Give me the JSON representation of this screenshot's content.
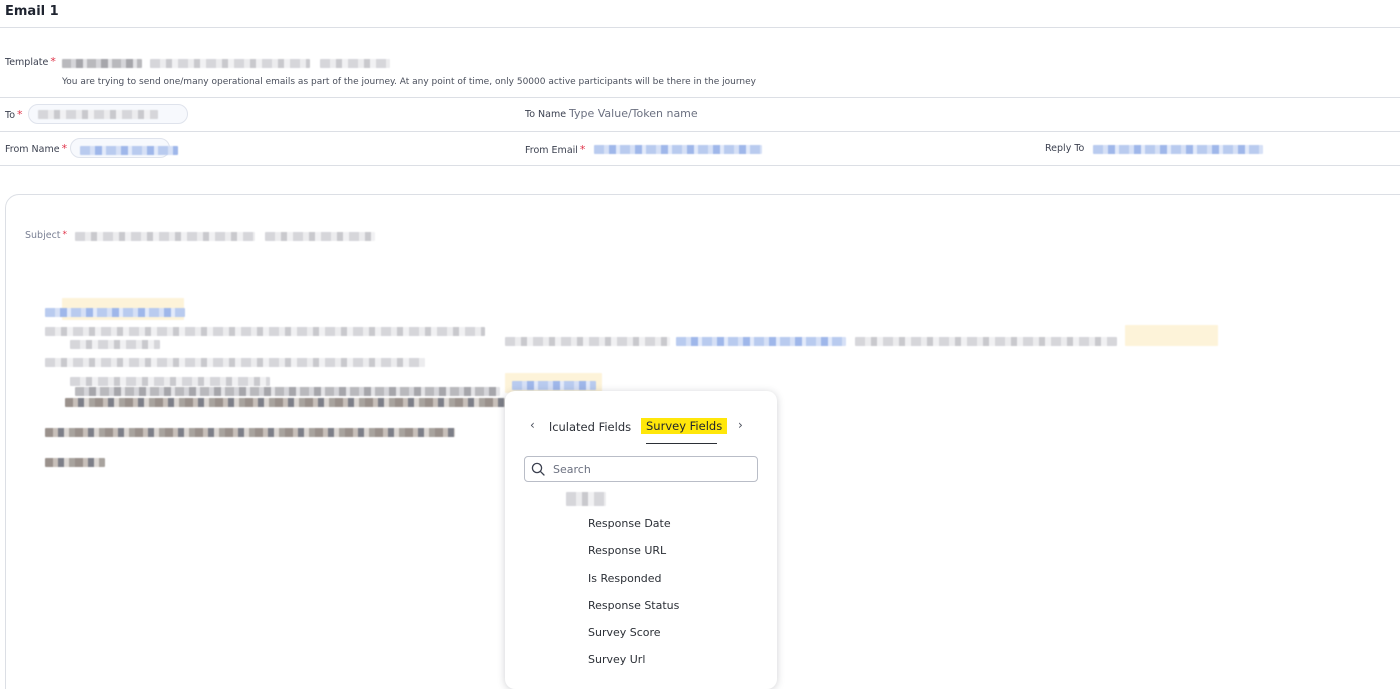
{
  "header": {
    "title": "Email 1"
  },
  "template": {
    "label": "Template",
    "required_mark": "*",
    "note": "You are trying to send one/many operational emails as part of the journey. At any point of time, only 50000 active participants will be there in the journey"
  },
  "recipient": {
    "to_label": "To",
    "to_name_label": "To Name",
    "to_name_placeholder": "Type Value/Token name",
    "from_name_label": "From Name",
    "from_email_label": "From Email",
    "reply_to_label": "Reply To",
    "required_mark": "*"
  },
  "editor": {
    "subject_label": "Subject",
    "required_mark": "*"
  },
  "token_picker": {
    "tabs": [
      {
        "label": "lculated Fields"
      },
      {
        "label": "Survey Fields",
        "active": true
      }
    ],
    "search_placeholder": "Search",
    "fields": [
      "Response Date",
      "Response URL",
      "Is Responded",
      "Response Status",
      "Survey Score",
      "Survey Url"
    ],
    "highlight_color": "#ffe70a"
  }
}
